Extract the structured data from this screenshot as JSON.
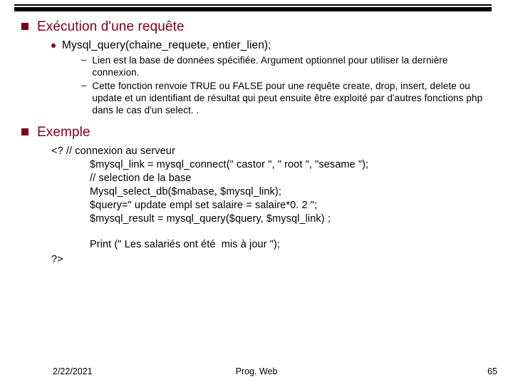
{
  "sections": {
    "exec": {
      "heading": "Exécution d'une requête",
      "sub": "Mysql_query(chaine_requete, entier_lien);",
      "points": [
        "Lien est la base de données spécifiée. Argument optionnel pour utiliser la dernière connexion.",
        "Cette fonction renvoie TRUE ou FALSE pour une requête create, drop,  insert, delete ou update et un identifiant de résultat qui peut ensuite être exploité par d'autres fonctions php dans le cas d'un select. ."
      ]
    },
    "example": {
      "heading": "Exemple",
      "open": "<?",
      "lines": [
        "// connexion au serveur",
        "$mysql_link = mysql_connect(\" castor \", \" root \", \"sesame \");",
        "// selection de la base",
        "Mysql_select_db($mabase, $mysql_link);",
        "$query=\" update empl set salaire = salaire*0. 2 \";",
        "$mysql_result = mysql_query($query, $mysql_link) ;"
      ],
      "print_line": "Print (\" Les salariés ont été  mis à jour \");",
      "close": "?>"
    }
  },
  "footer": {
    "date": "2/22/2021",
    "title": "Prog. Web",
    "page": "65"
  }
}
